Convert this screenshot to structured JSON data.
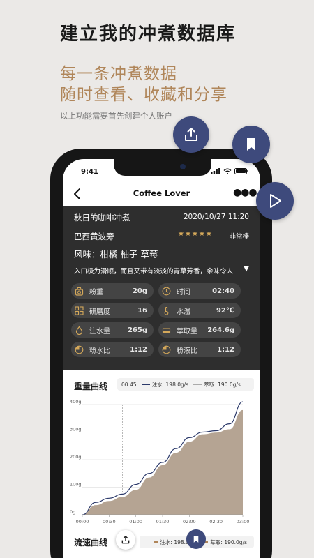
{
  "promo": {
    "headline": "建立我的冲煮数据库",
    "tagline_1": "每一条冲煮数据",
    "tagline_2": "随时查看、收藏和分享",
    "note": "以上功能需要首先创建个人账户"
  },
  "status_bar": {
    "time": "9:41"
  },
  "nav": {
    "title": "Coffee Lover"
  },
  "record": {
    "name": "秋日的咖啡冲煮",
    "datetime": "2020/10/27 11:20",
    "origin": "巴西黄波旁",
    "stars": "★★★★★",
    "rating_label": "非常棒",
    "flavor": "风味：柑橘 柚子 草莓",
    "description": "入口极为滑顺，而且又带有淡淡的青草芳香，余味令人",
    "expand_glyph": "▼",
    "params": [
      {
        "label": "粉重",
        "value": "20g",
        "icon": "scale-icon"
      },
      {
        "label": "时间",
        "value": "02:40",
        "icon": "clock-icon"
      },
      {
        "label": "研磨度",
        "value": "16",
        "icon": "grind-icon"
      },
      {
        "label": "水温",
        "value": "92℃",
        "icon": "thermometer-icon"
      },
      {
        "label": "注水量",
        "value": "265g",
        "icon": "water-drop-icon"
      },
      {
        "label": "萃取量",
        "value": "264.6g",
        "icon": "cup-icon"
      },
      {
        "label": "粉水比",
        "value": "1:12",
        "icon": "ratio-icon"
      },
      {
        "label": "粉液比",
        "value": "1:12",
        "icon": "ratio-icon"
      }
    ]
  },
  "weight_chart": {
    "title": "重量曲线",
    "legend_time": "00:45",
    "legend_pour": "注水: 198.0g/s",
    "legend_extract": "萃取: 190.0g/s"
  },
  "flow_chart": {
    "title": "流速曲线",
    "legend_pour": "注水: 198.0g/s",
    "legend_extract": "萃取: 190.0g/s"
  },
  "colors": {
    "accent": "#b0865a",
    "fab": "#3e4a7c",
    "pour_line": "#2c3a6b",
    "extract_fill": "#b5a493",
    "card_bg": "#2e2e2e"
  },
  "chart_data": {
    "type": "area",
    "title": "重量曲线",
    "x": [
      "00:00",
      "00:15",
      "00:30",
      "00:45",
      "01:00",
      "01:15",
      "01:30",
      "01:45",
      "02:00",
      "02:15",
      "02:30",
      "02:45",
      "03:00"
    ],
    "xticks": [
      "00:00",
      "00:30",
      "01:00",
      "01:30",
      "02:00",
      "02:30",
      "03:00"
    ],
    "yticks": [
      "0g",
      "100g",
      "200g",
      "300g",
      "400g"
    ],
    "ylim": [
      0,
      400
    ],
    "series": [
      {
        "name": "注水",
        "type": "line",
        "values": [
          0,
          45,
          60,
          75,
          110,
          150,
          190,
          240,
          280,
          300,
          305,
          330,
          410
        ]
      },
      {
        "name": "萃取",
        "type": "area",
        "values": [
          0,
          35,
          50,
          65,
          90,
          135,
          180,
          225,
          265,
          292,
          298,
          310,
          380
        ]
      }
    ],
    "marker_x": "00:45",
    "grid": true
  }
}
